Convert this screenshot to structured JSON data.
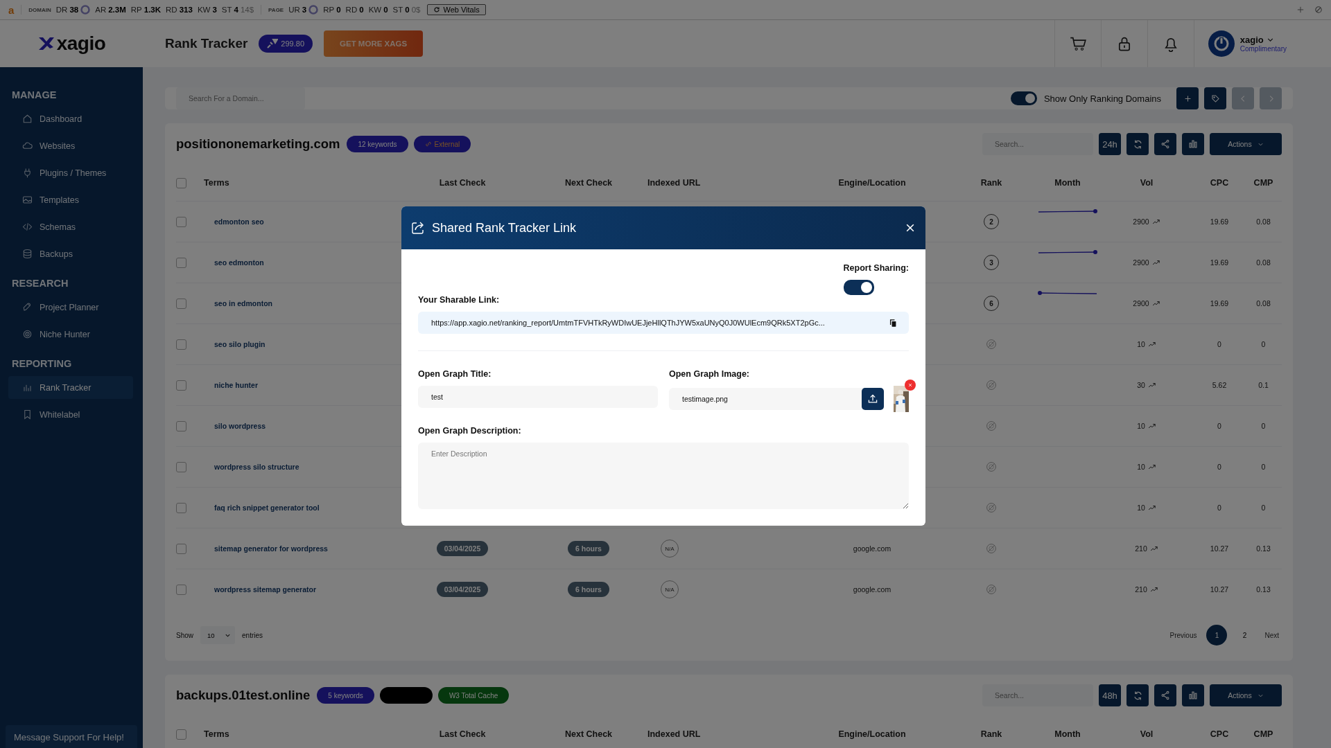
{
  "extension_bar": {
    "logo": "a",
    "groups": [
      {
        "label": "DOMAIN",
        "metrics": [
          {
            "key": "DR",
            "value": "38",
            "kind": "score"
          },
          {
            "key": "AR",
            "value": "2.3M",
            "kind": "plain"
          },
          {
            "key": "RP",
            "value": "1.3K",
            "kind": "plain"
          },
          {
            "key": "RD",
            "value": "313",
            "kind": "plain"
          },
          {
            "key": "KW",
            "value": "3",
            "kind": "plain"
          },
          {
            "key": "ST",
            "value": "4",
            "kind": "plain",
            "note": "14$"
          }
        ]
      },
      {
        "label": "PAGE",
        "metrics": [
          {
            "key": "UR",
            "value": "3",
            "kind": "score"
          },
          {
            "key": "RP",
            "value": "0",
            "kind": "plain"
          },
          {
            "key": "RD",
            "value": "0",
            "kind": "plain"
          },
          {
            "key": "KW",
            "value": "0",
            "kind": "plain"
          },
          {
            "key": "ST",
            "value": "0",
            "kind": "plain",
            "note": "0$"
          }
        ]
      }
    ],
    "button": "Web Vitals"
  },
  "header": {
    "logo": "xagio",
    "title": "Rank Tracker",
    "credits": "299.80",
    "cta": "GET MORE XAGS",
    "user": {
      "name": "xagio",
      "plan": "Complimentary"
    }
  },
  "sidebar": {
    "sections": [
      {
        "title": "MANAGE",
        "items": [
          {
            "label": "Dashboard",
            "selected": false
          },
          {
            "label": "Websites",
            "selected": false
          },
          {
            "label": "Plugins / Themes",
            "selected": false
          },
          {
            "label": "Templates",
            "selected": false
          },
          {
            "label": "Schemas",
            "selected": false
          },
          {
            "label": "Backups",
            "selected": false
          }
        ]
      },
      {
        "title": "RESEARCH",
        "items": [
          {
            "label": "Project Planner",
            "selected": false
          },
          {
            "label": "Niche Hunter",
            "selected": false
          }
        ]
      },
      {
        "title": "REPORTING",
        "items": [
          {
            "label": "Rank Tracker",
            "selected": true
          },
          {
            "label": "Whitelabel",
            "selected": false
          }
        ]
      }
    ],
    "support": "Message Support For Help!"
  },
  "filter": {
    "search_placeholder": "Search For a Domain...",
    "toggle": {
      "label": "Show Only Ranking Domains",
      "on": true
    },
    "nav_disabled": true
  },
  "domains": [
    {
      "name": "positiononemarketing.com",
      "badges": [
        {
          "text": "12 keywords",
          "kind": "count"
        },
        {
          "text": "External",
          "kind": "link"
        }
      ],
      "search_placeholder": "Search...",
      "period": "24h",
      "actions": "Actions",
      "columns": [
        "Terms",
        "Last Check",
        "Next Check",
        "Indexed URL",
        "Engine/Location",
        "Rank",
        "Month",
        "Vol",
        "CPC",
        "CMP"
      ],
      "all_checked": false,
      "rows": [
        {
          "term": "edmonton seo",
          "checked": false,
          "rank": "2",
          "rising": true,
          "vol": "2900",
          "cpc": "19.69",
          "cmp": "0.08"
        },
        {
          "term": "seo edmonton",
          "checked": false,
          "rank": "3",
          "rising": true,
          "vol": "2900",
          "cpc": "19.69",
          "cmp": "0.08"
        },
        {
          "term": "seo in edmonton",
          "checked": false,
          "rank": "6",
          "rising": false,
          "vol": "2900",
          "cpc": "19.69",
          "cmp": "0.08"
        },
        {
          "term": "seo silo plugin",
          "checked": false,
          "vol": "10",
          "cpc": "0",
          "cmp": "0"
        },
        {
          "term": "niche hunter",
          "checked": false,
          "vol": "30",
          "cpc": "5.62",
          "cmp": "0.1"
        },
        {
          "term": "silo wordpress",
          "checked": false,
          "vol": "10",
          "cpc": "0",
          "cmp": "0"
        },
        {
          "term": "wordpress silo structure",
          "checked": false,
          "vol": "10",
          "cpc": "0",
          "cmp": "0"
        },
        {
          "term": "faq rich snippet generator tool",
          "checked": false,
          "vol": "10",
          "cpc": "0",
          "cmp": "0"
        },
        {
          "term": "sitemap generator for wordpress",
          "checked": false,
          "last_check": "03/04/2025",
          "next_check": "6 hours",
          "indexed": "N/A",
          "engine": "google.com",
          "vol": "210",
          "cpc": "10.27",
          "cmp": "0.13"
        },
        {
          "term": "wordpress sitemap generator",
          "checked": false,
          "last_check": "03/04/2025",
          "next_check": "6 hours",
          "indexed": "N/A",
          "engine": "google.com",
          "vol": "210",
          "cpc": "10.27",
          "cmp": "0.13"
        }
      ],
      "footer": {
        "show": "Show",
        "page_size": "10",
        "entries": "entries",
        "previous": "Previous",
        "pages": [
          {
            "label": "1",
            "selected": true
          },
          {
            "label": "2",
            "selected": false
          }
        ],
        "next": "Next"
      }
    },
    {
      "name": "backups.01test.online",
      "badges": [
        {
          "text": "5 keywords",
          "kind": "count"
        },
        {
          "kind": "redacted"
        },
        {
          "text": "W3 Total Cache",
          "kind": "plugin"
        }
      ],
      "search_placeholder": "Search...",
      "period": "48h",
      "actions": "Actions",
      "columns": [
        "Terms",
        "Last Check",
        "Next Check",
        "Indexed URL",
        "Engine/Location",
        "Rank",
        "Month",
        "Vol",
        "CPC",
        "CMP"
      ],
      "all_checked": false
    }
  ],
  "modal": {
    "title": "Shared Rank Tracker Link",
    "sharing_label": "Report Sharing:",
    "sharing_on": true,
    "link_label": "Your Sharable Link:",
    "link": "https://app.xagio.net/ranking_report/UmtmTFVHTkRyWDIwUEJjeHllQThJYW5xaUNyQ0J0WUlEcm9QRk5XT2pGc...",
    "og_title_label": "Open Graph Title:",
    "og_title": "test",
    "og_image_label": "Open Graph Image:",
    "og_image": "testimage.png",
    "og_description_label": "Open Graph Description:",
    "og_description_placeholder": "Enter Description"
  }
}
